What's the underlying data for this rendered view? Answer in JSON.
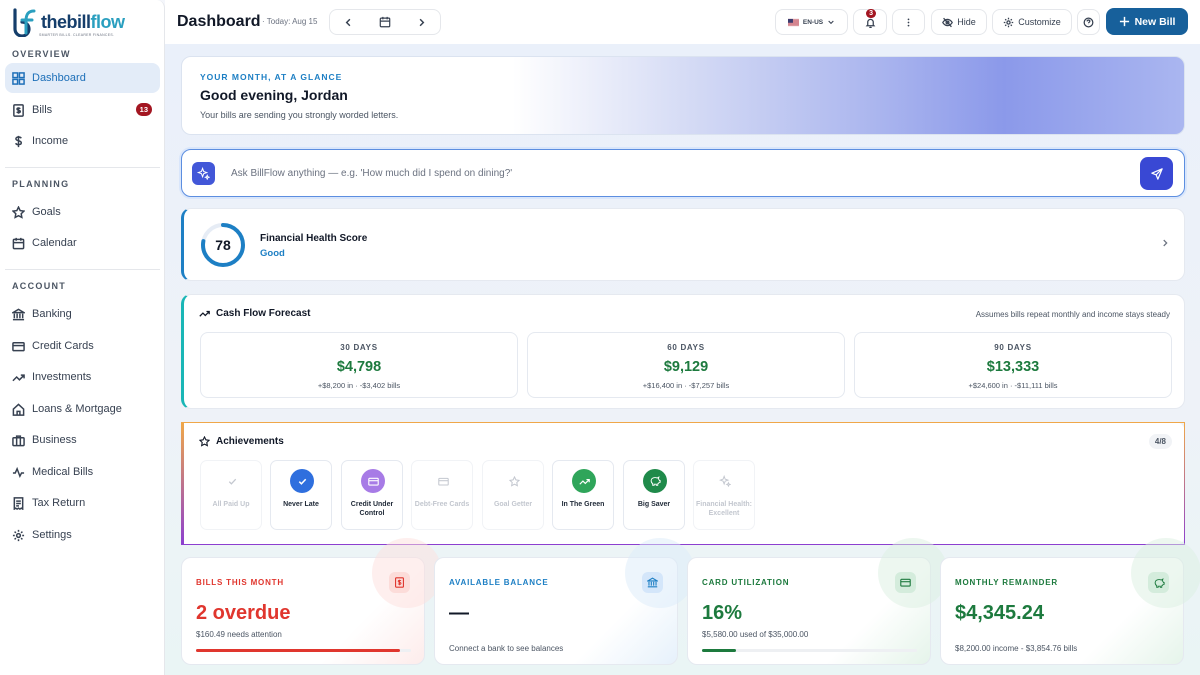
{
  "brand": {
    "name_a": "the",
    "name_b": "bill",
    "name_c": "flow",
    "tagline": "SMARTER BILLS. CLEARER FINANCES."
  },
  "sidebar": {
    "overview_heading": "OVERVIEW",
    "planning_heading": "PLANNING",
    "account_heading": "ACCOUNT",
    "items": [
      {
        "label": "Dashboard",
        "icon": "dashboard-icon",
        "active": true
      },
      {
        "label": "Bills",
        "icon": "bill-icon",
        "badge": "13"
      },
      {
        "label": "Income",
        "icon": "dollar-icon"
      },
      {
        "label": "Goals",
        "icon": "star-icon"
      },
      {
        "label": "Calendar",
        "icon": "calendar-icon"
      },
      {
        "label": "Banking",
        "icon": "bank-icon"
      },
      {
        "label": "Credit Cards",
        "icon": "credit-card-icon"
      },
      {
        "label": "Investments",
        "icon": "trend-icon"
      },
      {
        "label": "Loans & Mortgage",
        "icon": "home-icon"
      },
      {
        "label": "Business",
        "icon": "briefcase-icon"
      },
      {
        "label": "Medical Bills",
        "icon": "pulse-icon"
      },
      {
        "label": "Tax Return",
        "icon": "receipt-icon"
      },
      {
        "label": "Settings",
        "icon": "gear-icon"
      }
    ]
  },
  "topbar": {
    "title": "Dashboard",
    "today": "· Today: Aug 15",
    "locale": "EN-US",
    "notifications": "3",
    "hide_label": "Hide",
    "customize_label": "Customize",
    "new_bill_label": "New Bill"
  },
  "hero": {
    "kicker": "YOUR MONTH, AT A GLANCE",
    "greeting": "Good evening, Jordan",
    "subtitle": "Your bills are sending you strongly worded letters."
  },
  "ask": {
    "placeholder": "Ask BillFlow anything — e.g. 'How much did I spend on dining?'"
  },
  "health": {
    "score": "78",
    "score_value": 78,
    "label": "Financial Health Score",
    "status": "Good"
  },
  "cashflow": {
    "title": "Cash Flow Forecast",
    "note": "Assumes bills repeat monthly and income stays steady",
    "periods": [
      {
        "days": "30 DAYS",
        "value": "$4,798",
        "breakdown": "+$8,200 in · -$3,402 bills"
      },
      {
        "days": "60 DAYS",
        "value": "$9,129",
        "breakdown": "+$16,400 in · -$7,257 bills"
      },
      {
        "days": "90 DAYS",
        "value": "$13,333",
        "breakdown": "+$24,600 in · -$11,111 bills"
      }
    ]
  },
  "achievements": {
    "title": "Achievements",
    "count": "4/8",
    "items": [
      {
        "label": "All Paid Up",
        "earned": false,
        "icon": "check-icon"
      },
      {
        "label": "Never Late",
        "earned": true,
        "icon": "check-icon",
        "color": "#2f6fde"
      },
      {
        "label": "Credit Under Control",
        "earned": true,
        "icon": "credit-card-icon",
        "color": "#a77be6"
      },
      {
        "label": "Debt-Free Cards",
        "earned": false,
        "icon": "credit-card-icon"
      },
      {
        "label": "Goal Getter",
        "earned": false,
        "icon": "star-icon"
      },
      {
        "label": "In The Green",
        "earned": true,
        "icon": "trend-icon",
        "color": "#2fa55a"
      },
      {
        "label": "Big Saver",
        "earned": true,
        "icon": "piggy-bank-icon",
        "color": "#1f8a4a"
      },
      {
        "label": "Financial Health: Excellent",
        "earned": false,
        "icon": "sparkle-icon"
      }
    ]
  },
  "stats": [
    {
      "key": "BILLS THIS MONTH",
      "value": "2 overdue",
      "sub": "$160.49 needs attention",
      "color": "#e0362e",
      "icon": "dollar-icon",
      "progress": 0.95
    },
    {
      "key": "AVAILABLE BALANCE",
      "value": "—",
      "sub": "Connect a bank to see balances",
      "color": "#1d7fc4",
      "icon": "bank-icon"
    },
    {
      "key": "CARD UTILIZATION",
      "value": "16%",
      "sub": "$5,580.00 used of $35,000.00",
      "color": "#1d7a3e",
      "icon": "credit-card-icon",
      "progress": 0.16
    },
    {
      "key": "MONTHLY REMAINDER",
      "value": "$4,345.24",
      "sub": "$8,200.00 income - $3,854.76 bills",
      "color": "#1d7a3e",
      "icon": "piggy-bank-icon"
    }
  ]
}
